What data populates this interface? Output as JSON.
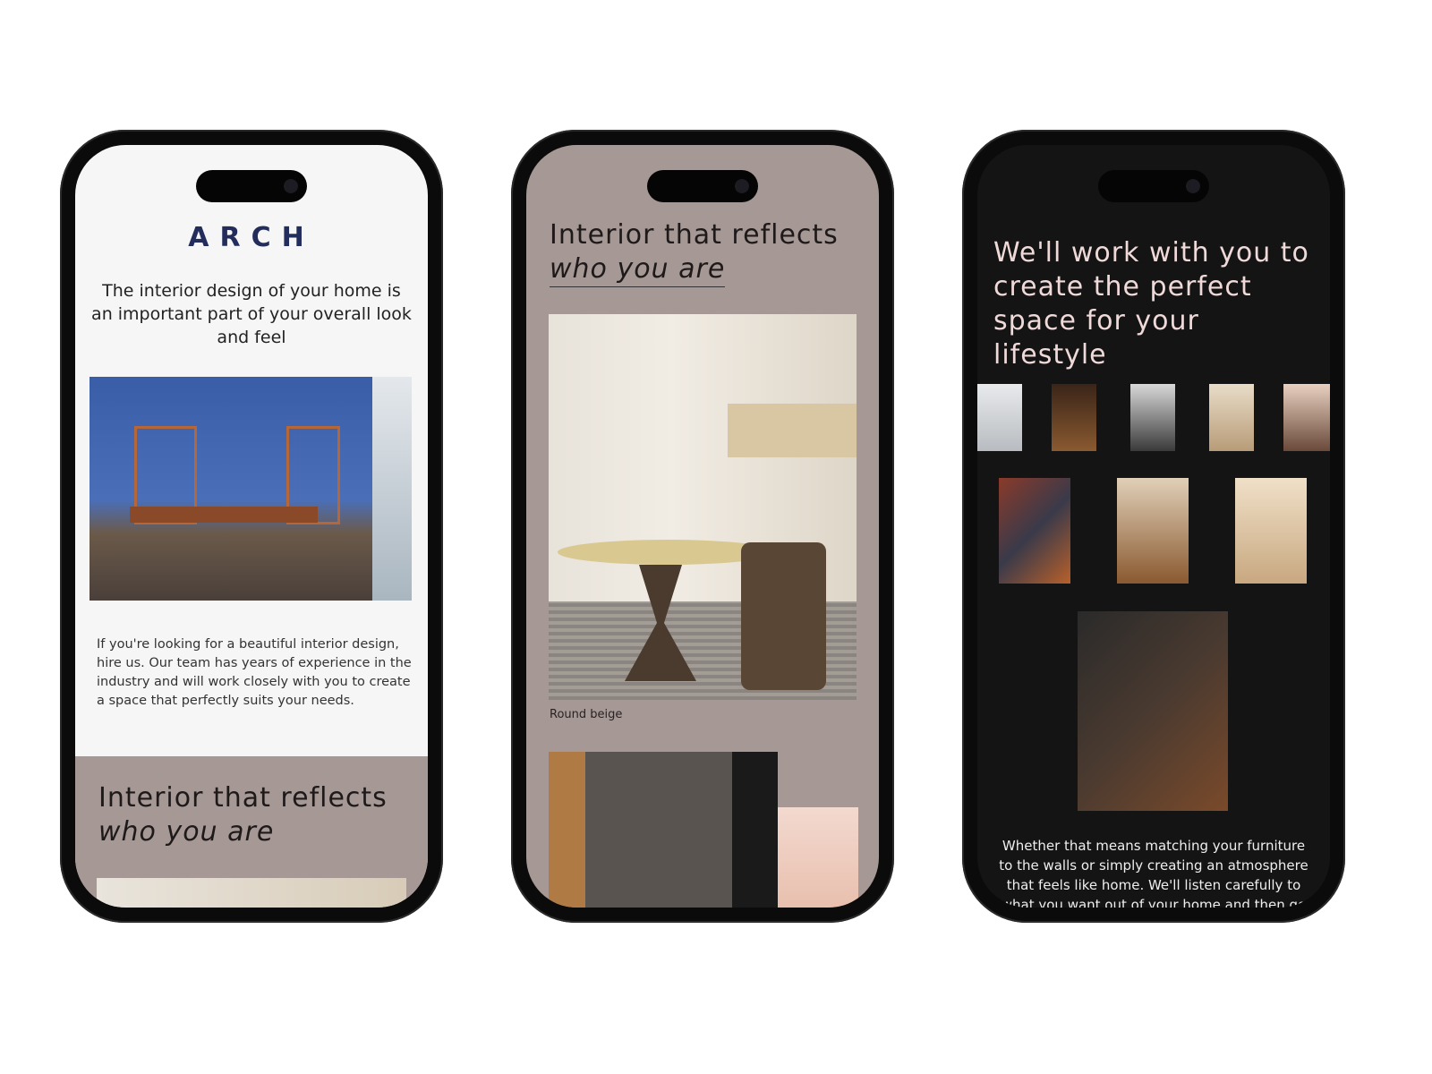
{
  "phone1": {
    "logo": "ARCH",
    "intro": "The interior design of your home is an important part of your overall look and feel",
    "body": "If you're looking for a beautiful interior design, hire us. Our team has years of experience in the industry and will work closely with you to create a space that perfectly suits your needs.",
    "section_title_line1": "Interior that reflects",
    "section_title_line2": "who you are"
  },
  "phone2": {
    "title_line1": "Interior that reflects",
    "title_line2": "who you are",
    "caption": "Round beige"
  },
  "phone3": {
    "title": "We'll work with you to create the perfect space for your lifestyle",
    "body": "Whether that means matching your furniture to the walls or simply creating an atmosphere that feels like home. We'll listen carefully to what you want out of your home and then go above and"
  },
  "colors": {
    "brand": "#232d5c",
    "taupe": "#a59895",
    "dark": "#141414",
    "light": "#f6f6f6"
  }
}
